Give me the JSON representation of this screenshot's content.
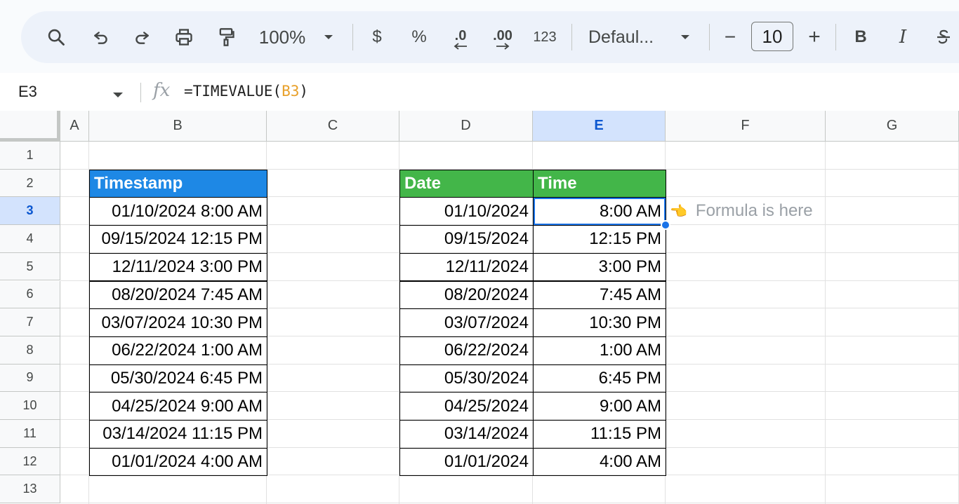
{
  "toolbar": {
    "zoom": "100%",
    "currency": "$",
    "percent": "%",
    "decrease_decimal": ".0",
    "increase_decimal": ".00",
    "number_format": "123",
    "font_family": "Defaul...",
    "font_size": "10",
    "minus": "−",
    "plus": "+",
    "bold": "B",
    "italic": "I"
  },
  "formula_bar": {
    "name_box": "E3",
    "fx": "fx",
    "formula_prefix": "=TIMEVALUE(",
    "formula_ref": "B3",
    "formula_suffix": ")"
  },
  "columns": [
    "A",
    "B",
    "C",
    "D",
    "E",
    "F",
    "G"
  ],
  "rows": [
    "1",
    "2",
    "3",
    "4",
    "5",
    "6",
    "7",
    "8",
    "9",
    "10",
    "11",
    "12",
    "13"
  ],
  "active_cell": {
    "column": "E",
    "row": "3"
  },
  "sheet": {
    "b_header": "Timestamp",
    "d_header": "Date",
    "e_header": "Time",
    "timestamps": [
      "01/10/2024 8:00 AM",
      "09/15/2024 12:15 PM",
      "12/11/2024 3:00 PM",
      "08/20/2024 7:45 AM",
      "03/07/2024 10:30 PM",
      "06/22/2024 1:00 AM",
      "05/30/2024 6:45 PM",
      "04/25/2024 9:00 AM",
      "03/14/2024 11:15 PM",
      "01/01/2024 4:00 AM"
    ],
    "dates": [
      "01/10/2024",
      "09/15/2024",
      "12/11/2024",
      "08/20/2024",
      "03/07/2024",
      "06/22/2024",
      "05/30/2024",
      "04/25/2024",
      "03/14/2024",
      "01/01/2024"
    ],
    "times": [
      "8:00 AM",
      "12:15 PM",
      "3:00 PM",
      "7:45 AM",
      "10:30 PM",
      "1:00 AM",
      "6:45 PM",
      "9:00 AM",
      "11:15 PM",
      "4:00 AM"
    ],
    "note_emoji": "👈",
    "note": "Formula is here"
  },
  "colors": {
    "timestamp_header": "#1e88e5",
    "date_time_header": "#43b649",
    "selection": "#1a73e8",
    "note_text": "#9aa0a6"
  }
}
